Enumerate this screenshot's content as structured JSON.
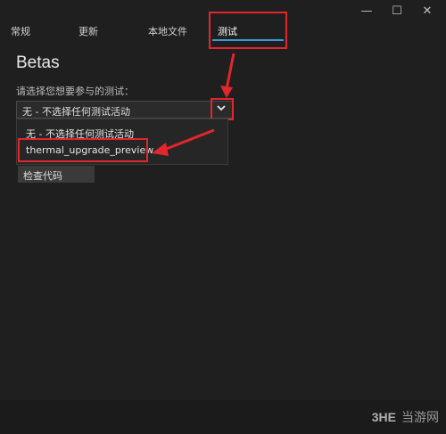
{
  "window": {
    "minimize": "—",
    "maximize": "☐",
    "close": "✕"
  },
  "tabs": [
    {
      "label": "常规"
    },
    {
      "label": "更新"
    },
    {
      "label": "本地文件"
    },
    {
      "label": "测试"
    }
  ],
  "page_title": "Betas",
  "prompt": "请选择您想要参与的测试：",
  "select": {
    "value": "无 - 不选择任何测试活动"
  },
  "options": [
    {
      "label": "无 - 不选择任何测试活动"
    },
    {
      "label": "thermal_upgrade_preview -"
    }
  ],
  "check_code_button": "检查代码",
  "watermark": {
    "logo": "3HE",
    "site": "当游网"
  },
  "colors": {
    "highlight": "#e3262b",
    "accent": "#3a9bd8",
    "background": "#1f1f1f"
  }
}
